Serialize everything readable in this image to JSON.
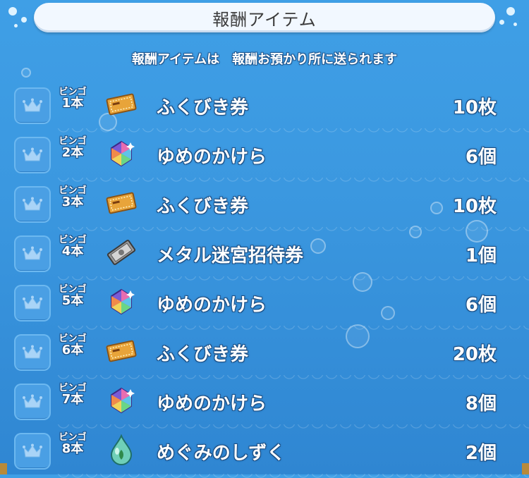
{
  "title": "報酬アイテム",
  "notice": "報酬アイテムは　報酬お預かり所に送られます",
  "bingo_prefix": "ビンゴ",
  "rewards": [
    {
      "bingo": "1本",
      "icon": "ticket-icon",
      "name": "ふくびき券",
      "qty": "10枚"
    },
    {
      "bingo": "2本",
      "icon": "dream-shard-icon",
      "name": "ゆめのかけら",
      "qty": "6個"
    },
    {
      "bingo": "3本",
      "icon": "ticket-icon",
      "name": "ふくびき券",
      "qty": "10枚"
    },
    {
      "bingo": "4本",
      "icon": "metal-ticket-icon",
      "name": "メタル迷宮招待券",
      "qty": "1個"
    },
    {
      "bingo": "5本",
      "icon": "dream-shard-icon",
      "name": "ゆめのかけら",
      "qty": "6個"
    },
    {
      "bingo": "6本",
      "icon": "ticket-icon",
      "name": "ふくびき券",
      "qty": "20枚"
    },
    {
      "bingo": "7本",
      "icon": "dream-shard-icon",
      "name": "ゆめのかけら",
      "qty": "8個"
    },
    {
      "bingo": "8本",
      "icon": "blessing-drop-icon",
      "name": "めぐみのしずく",
      "qty": "2個"
    }
  ]
}
